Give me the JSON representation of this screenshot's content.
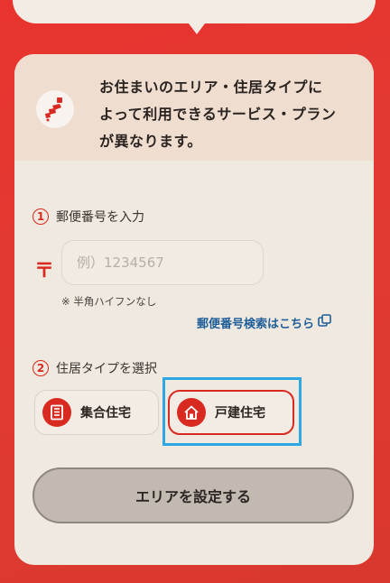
{
  "header": {
    "message_line1": "お住まいのエリア・住居タイプに",
    "message_line2": "よって利用できるサービス・プラン",
    "message_line3": "が異なります。"
  },
  "step1": {
    "number": "1",
    "label": "郵便番号を入力",
    "postal_mark": "〒",
    "input_placeholder": "例）1234567",
    "input_value": "",
    "note": "※ 半角ハイフンなし",
    "search_link": "郵便番号検索はこちら"
  },
  "step2": {
    "number": "2",
    "label": "住居タイプを選択",
    "options": [
      {
        "label": "集合住宅",
        "icon": "apartment-icon",
        "selected": false
      },
      {
        "label": "戸建住宅",
        "icon": "house-icon",
        "selected": true
      }
    ]
  },
  "submit_label": "エリアを設定する",
  "colors": {
    "background": "#e2352f",
    "accent": "#d92a22",
    "link": "#1f5e9a",
    "highlight": "#2fa7e0"
  }
}
